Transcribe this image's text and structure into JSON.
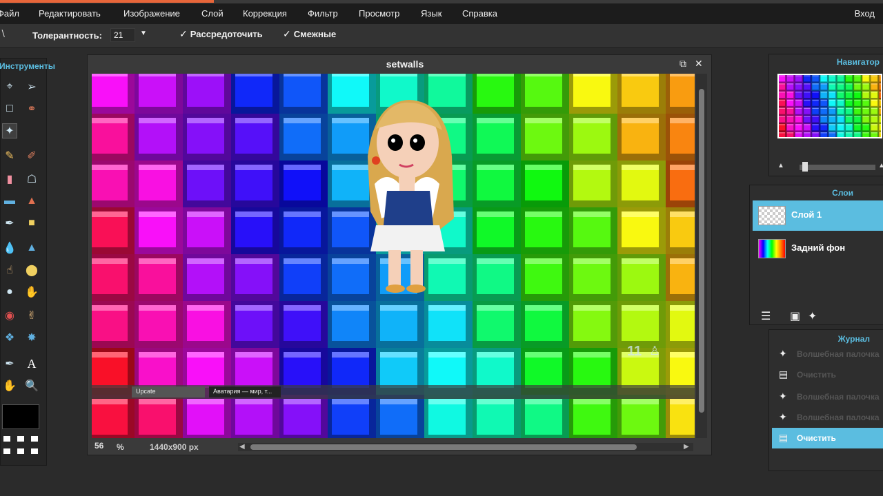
{
  "menu": {
    "items": [
      "Файл",
      "Редактировать",
      "Изображение",
      "Слой",
      "Коррекция",
      "Фильтр",
      "Просмотр",
      "Язык",
      "Справка"
    ],
    "login": "Вход"
  },
  "options": {
    "tolerance_label": "Толерантность:",
    "tolerance_value": "21",
    "antialias_label": "Рассредоточить",
    "antialias_checked": true,
    "contiguous_label": "Смежные",
    "contiguous_checked": true
  },
  "tools": {
    "title": "Инструменты",
    "icons": [
      "crop-icon",
      "move-icon",
      "marquee-icon",
      "lasso-icon",
      "magic-wand-icon",
      "pencil-icon",
      "brush-icon",
      "eraser-icon",
      "bucket-icon",
      "gradient-icon",
      "clone-stamp-icon",
      "color-replace-icon",
      "drawing-icon",
      "blur-icon",
      "sharpen-icon",
      "smudge-icon",
      "sponge-icon",
      "dodge-icon",
      "burn-icon",
      "red-eye-icon",
      "spot-heal-icon",
      "bloat-icon",
      "pinch-icon",
      "color-picker-icon",
      "type-icon",
      "hand-icon",
      "zoom-icon"
    ],
    "foreground_color": "#000000"
  },
  "document": {
    "title": "setwalls",
    "zoom": "56",
    "zoom_unit": "%",
    "dimensions": "1440x900 px",
    "badge_number": "11",
    "taskbar_items": [
      "Upcate",
      "Аватария — мир, т..."
    ]
  },
  "navigator": {
    "title": "Навигатор"
  },
  "layers": {
    "title": "Слои",
    "items": [
      {
        "name": "Слой 1",
        "selected": true
      },
      {
        "name": "Задний фон",
        "selected": false
      }
    ]
  },
  "journal": {
    "title": "Журнал",
    "items": [
      {
        "label": "Волшебная палочка",
        "icon": "magic-wand-icon",
        "selected": false
      },
      {
        "label": "Очистить",
        "icon": "clear-icon",
        "selected": false
      },
      {
        "label": "Волшебная палочка",
        "icon": "magic-wand-icon",
        "selected": false
      },
      {
        "label": "Волшебная палочка",
        "icon": "magic-wand-icon",
        "selected": false
      },
      {
        "label": "Очистить",
        "icon": "clear-icon",
        "selected": true
      }
    ]
  },
  "colors": {
    "accent": "#5bbde0",
    "panel": "#2e2e2e",
    "menubar": "#1c1c1c"
  }
}
